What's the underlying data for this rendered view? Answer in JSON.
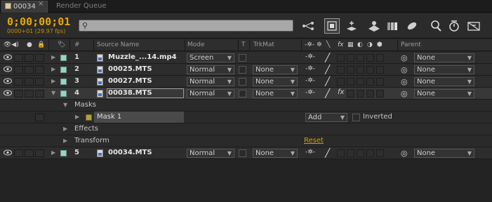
{
  "tabs": {
    "comp_tab": "00034",
    "close": "×",
    "render_queue": "Render Queue"
  },
  "toolbar": {
    "timecode": "0;00;00;01",
    "frame_info": "0000+01 (29.97 fps)",
    "search_placeholder": "",
    "search_icon": "⚲",
    "icons": [
      "comp-mini-flowchart-icon",
      "draft-3d-icon",
      "shy-layers-icon",
      "frame-blending-icon",
      "motion-blur-icon",
      "graph-editor-icon",
      "live-update-icon",
      "brainstorm-icon",
      "auto-keyframe-icon",
      "tag-icon"
    ]
  },
  "header": {
    "hash": "#",
    "source_name": "Source Name",
    "mode": "Mode",
    "t": "T",
    "trkmat": "TrkMat",
    "fx": "fx",
    "parent": "Parent"
  },
  "layers": [
    {
      "num": "1",
      "name": "Muzzle_...14.mp4",
      "mode": "Screen",
      "trkmat": "",
      "parent": "None"
    },
    {
      "num": "2",
      "name": "00025.MTS",
      "mode": "Normal",
      "trkmat": "None",
      "parent": "None"
    },
    {
      "num": "3",
      "name": "00027.MTS",
      "mode": "Normal",
      "trkmat": "None",
      "parent": "None"
    },
    {
      "num": "4",
      "name": "00038.MTS",
      "mode": "Normal",
      "trkmat": "None",
      "parent": "None"
    },
    {
      "num": "5",
      "name": "00034.MTS",
      "mode": "Normal",
      "trkmat": "None",
      "parent": "None"
    }
  ],
  "layer4_props": {
    "masks": "Masks",
    "mask1": "Mask 1",
    "mask_mode": "Add",
    "inverted": "Inverted",
    "effects": "Effects",
    "transform": "Transform",
    "reset": "Reset"
  },
  "glyphs": {
    "arrow": "▼",
    "expand": "▶",
    "collapse": "▼",
    "pickwhip": "◎",
    "slash": "╱",
    "shy": "-✲-",
    "fx": "fx"
  },
  "colors": {
    "timecode": "#e8a800",
    "reset_link": "#d79a00",
    "label_aqua": "#9fd0c4",
    "mask_label": "#b0a13a"
  }
}
